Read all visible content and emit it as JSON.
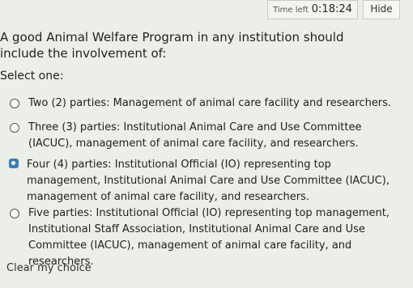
{
  "header": {
    "timer_label": "Time left",
    "timer_value": "0:18:24",
    "hide_label": "Hide"
  },
  "question": {
    "text": "A good Animal Welfare Program in any institution should include the involvement of:",
    "instruction": "Select one:"
  },
  "options": [
    {
      "label": "Two (2) parties: Management of animal care facility and researchers.",
      "selected": false
    },
    {
      "label": "Three (3) parties: Institutional Animal Care and Use Committee (IACUC), management of animal care facility, and researchers.",
      "selected": false
    },
    {
      "label": "Four (4) parties: Institutional Official (IO) representing top management, Institutional Animal Care and Use Committee (IACUC), management of animal care facility, and researchers.",
      "selected": true
    },
    {
      "label": "Five parties: Institutional Official (IO) representing top management, Institutional Staff Association, Institutional Animal Care and Use Committee (IACUC), management of animal care facility, and researchers.",
      "selected": false
    }
  ],
  "clear_label": "Clear my choice"
}
